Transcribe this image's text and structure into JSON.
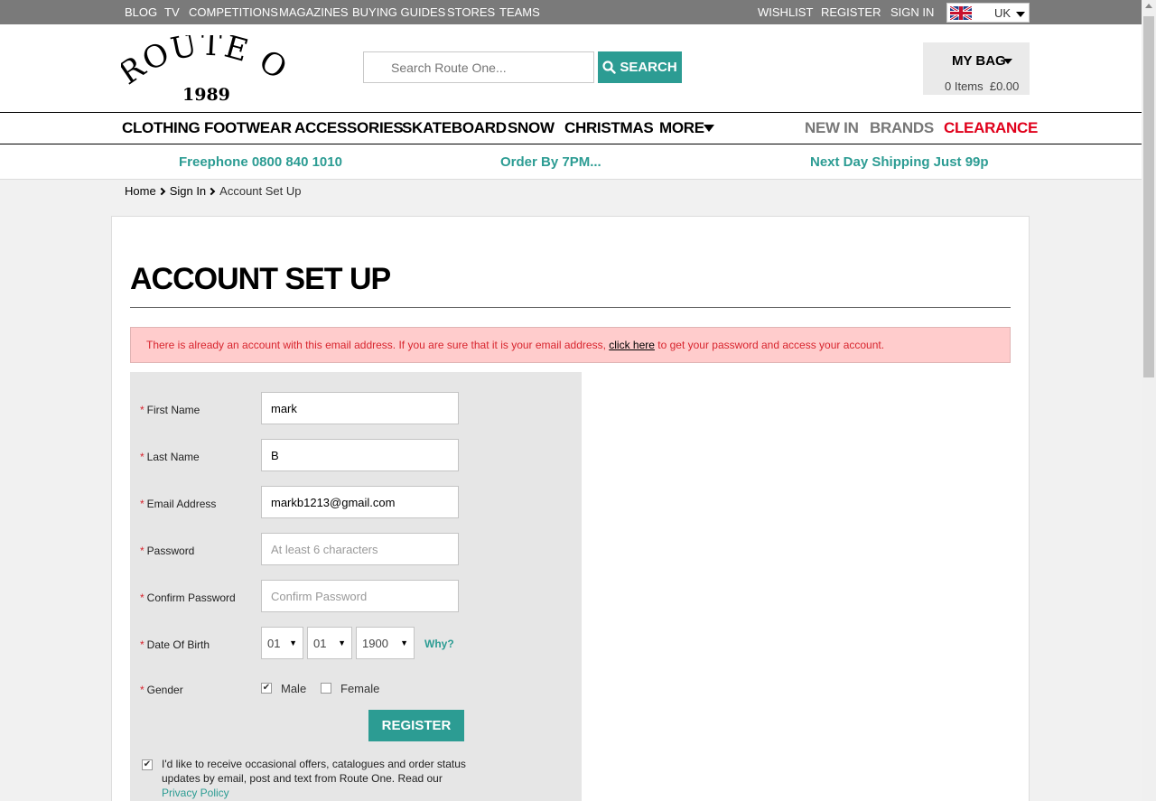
{
  "topbar": {
    "left_links": [
      "BLOG",
      "TV",
      "COMPETITIONS",
      "MAGAZINES",
      "BUYING GUIDES",
      "STORES",
      "TEAMS"
    ],
    "right_links": [
      "WISHLIST",
      "REGISTER",
      "SIGN IN"
    ],
    "locale": "UK"
  },
  "header": {
    "logo_text": "ROUTE ONE",
    "logo_year": "1989",
    "search_placeholder": "Search Route One...",
    "search_button": "SEARCH",
    "bag_title": "MY BAG",
    "bag_summary": "0 Items  £0.00"
  },
  "nav": {
    "left": [
      "CLOTHING",
      "FOOTWEAR",
      "ACCESSORIES",
      "SKATEBOARD",
      "SNOW",
      "CHRISTMAS",
      "MORE"
    ],
    "right": [
      "NEW IN",
      "BRANDS",
      "CLEARANCE"
    ],
    "colors": {
      "grey": "#777777",
      "clearance": "#e0001b"
    }
  },
  "promo": [
    "Freephone 0800 840 1010",
    "Order By 7PM...",
    "Next Day Shipping Just 99p"
  ],
  "breadcrumb": [
    "Home",
    "Sign In",
    "Account Set Up"
  ],
  "page": {
    "title": "ACCOUNT SET UP",
    "alert": {
      "before": "There is already an account with this email address. If you are sure that it is your email address, ",
      "link": "click here",
      "after": " to get your password and access your account."
    }
  },
  "form": {
    "first_name": {
      "label": "First Name",
      "value": "mark"
    },
    "last_name": {
      "label": "Last Name",
      "value": "B"
    },
    "email": {
      "label": "Email Address",
      "value": "markb1213@gmail.com"
    },
    "password": {
      "label": "Password",
      "placeholder": "At least 6 characters"
    },
    "confirm_password": {
      "label": "Confirm Password",
      "placeholder": "Confirm Password"
    },
    "dob": {
      "label": "Date Of Birth",
      "day": "01",
      "month": "01",
      "year": "1900",
      "why": "Why?"
    },
    "gender": {
      "label": "Gender",
      "male": "Male",
      "female": "Female",
      "male_checked": true,
      "female_checked": false
    },
    "register_button": "REGISTER",
    "optin": {
      "checked": true,
      "text": "I'd like to receive occasional offers, catalogues and order status updates by email, post and text from Route One. Read our ",
      "link": "Privacy Policy"
    }
  },
  "theme": {
    "accent": "#2c9c93",
    "alert_bg": "#ffcccc",
    "alert_text": "#d8252e"
  }
}
